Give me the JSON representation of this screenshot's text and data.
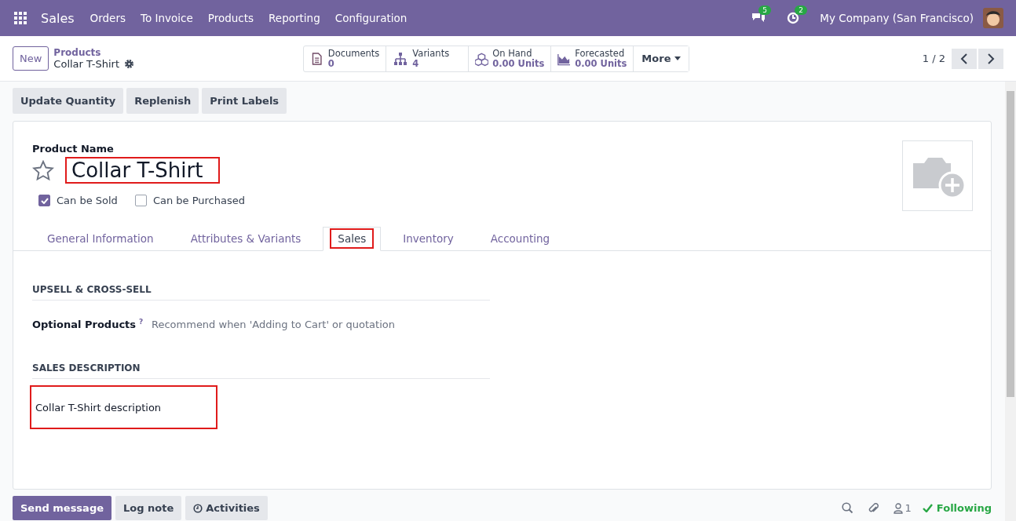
{
  "navbar": {
    "app": "Sales",
    "menu": [
      "Orders",
      "To Invoice",
      "Products",
      "Reporting",
      "Configuration"
    ],
    "messages_badge": "5",
    "activities_badge": "2",
    "company": "My Company (San Francisco)"
  },
  "control_panel": {
    "new_button": "New",
    "breadcrumb": "Products",
    "record": "Collar T-Shirt",
    "smart_buttons": [
      {
        "kind": "documents",
        "label": "Documents",
        "value": "0"
      },
      {
        "kind": "variants",
        "label": "Variants",
        "value": "4"
      },
      {
        "kind": "onhand",
        "label": "On Hand",
        "value": "0.00 Units"
      },
      {
        "kind": "forecast",
        "label": "Forecasted",
        "value": "0.00 Units"
      }
    ],
    "more": "More",
    "pager": "1 / 2"
  },
  "action_buttons": [
    "Update Quantity",
    "Replenish",
    "Print Labels"
  ],
  "form": {
    "name_label": "Product Name",
    "name": "Collar T-Shirt",
    "name_highlighted": true,
    "favorite": false,
    "checkboxes": [
      {
        "label": "Can be Sold",
        "checked": true
      },
      {
        "label": "Can be Purchased",
        "checked": false
      }
    ],
    "tabs": [
      {
        "label": "General Information",
        "selected": false,
        "highlighted": false
      },
      {
        "label": "Attributes & Variants",
        "selected": false,
        "highlighted": false
      },
      {
        "label": "Sales",
        "selected": true,
        "highlighted": true
      },
      {
        "label": "Inventory",
        "selected": false,
        "highlighted": false
      },
      {
        "label": "Accounting",
        "selected": false,
        "highlighted": false
      }
    ],
    "upsell_heading": "UPSELL & CROSS-SELL",
    "optional_label": "Optional Products",
    "optional_help": "?",
    "optional_placeholder": "Recommend when 'Adding to Cart' or quotation",
    "description_heading": "SALES DESCRIPTION",
    "description": "Collar T-Shirt description",
    "description_highlighted": true
  },
  "chatter": {
    "buttons": [
      {
        "label": "Send message",
        "selected": true,
        "kind": "plain"
      },
      {
        "label": "Log note",
        "selected": false,
        "kind": "plain"
      },
      {
        "label": "Activities",
        "selected": false,
        "kind": "clock"
      }
    ],
    "followers": "1",
    "following": "Following"
  }
}
